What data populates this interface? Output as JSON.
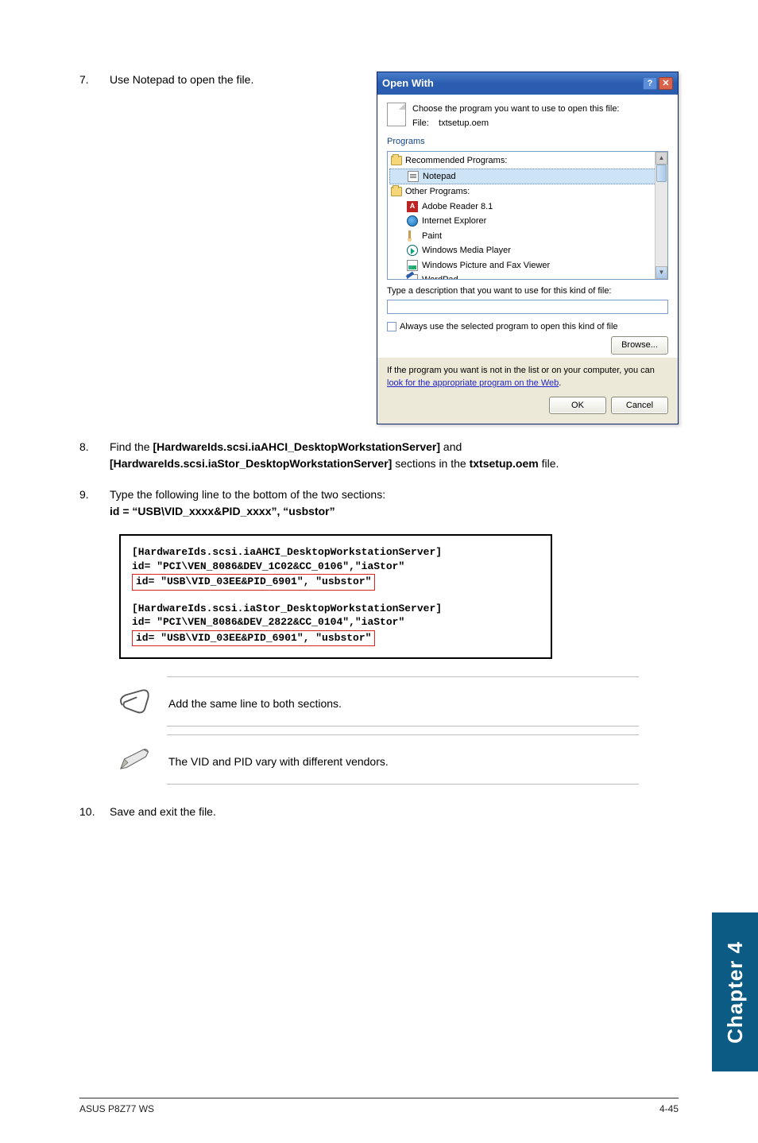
{
  "steps": {
    "s7": {
      "num": "7.",
      "text": "Use Notepad to open the file."
    },
    "s8": {
      "num": "8.",
      "prefix": "Find the ",
      "b1": "[HardwareIds.scsi.iaAHCI_DesktopWorkstationServer]",
      "and": " and ",
      "b2": "[HardwareIds.scsi.iaStor_DesktopWorkstationServer]",
      "mid": " sections in the ",
      "b3": "txtsetup.oem",
      "suffix": " file."
    },
    "s9": {
      "num": "9.",
      "line1": "Type the following line to the bottom of the two sections:",
      "line2": "id = “USB\\VID_xxxx&PID_xxxx”, “usbstor”"
    },
    "s10": {
      "num": "10.",
      "text": "Save and exit the file."
    }
  },
  "dialog": {
    "title": "Open With",
    "help": "?",
    "close": "✕",
    "prompt": "Choose the program you want to use to open this file:",
    "file_label": "File:",
    "file_name": "txtsetup.oem",
    "programs_label": "Programs",
    "group_rec": "Recommended Programs:",
    "item_notepad": "Notepad",
    "group_other": "Other Programs:",
    "item_adobe": "Adobe Reader 8.1",
    "item_ie": "Internet Explorer",
    "item_paint": "Paint",
    "item_wmp": "Windows Media Player",
    "item_fax": "Windows Picture and Fax Viewer",
    "item_wordpad": "WordPad",
    "desc_label": "Type a description that you want to use for this kind of file:",
    "checkbox": "Always use the selected program to open this kind of file",
    "browse": "Browse...",
    "note_pre": "If the program you want is not in the list or on your computer, you can ",
    "note_link": "look for the appropriate program on the Web",
    "note_post": ".",
    "ok": "OK",
    "cancel": "Cancel"
  },
  "code": {
    "h1": "[HardwareIds.scsi.iaAHCI_DesktopWorkstationServer]",
    "l1": "id= \"PCI\\VEN_8086&DEV_1C02&CC_0106\",\"iaStor\"",
    "hl1": "id= \"USB\\VID_03EE&PID_6901\", \"usbstor\"",
    "h2": "[HardwareIds.scsi.iaStor_DesktopWorkstationServer]",
    "l2": "id= \"PCI\\VEN_8086&DEV_2822&CC_0104\",\"iaStor\"",
    "hl2": "id= \"USB\\VID_03EE&PID_6901\", \"usbstor\""
  },
  "notes": {
    "n1": "Add the same line to both sections.",
    "n2": "The VID and PID vary with different vendors."
  },
  "sidetab": "Chapter 4",
  "footer": {
    "left": "ASUS P8Z77 WS",
    "right": "4-45"
  }
}
